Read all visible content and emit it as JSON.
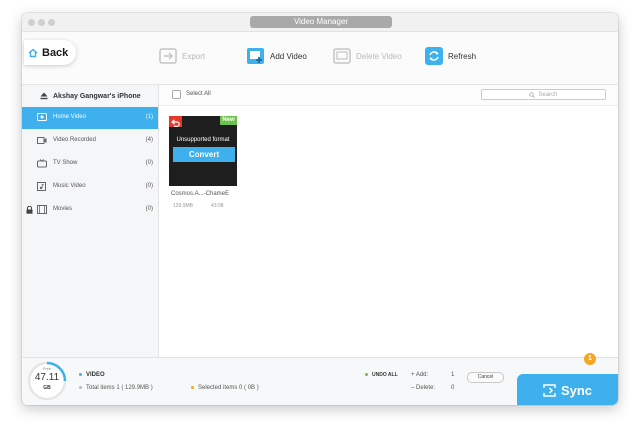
{
  "window": {
    "title": "Video Manager"
  },
  "toolbar": {
    "back": "Back",
    "export": "Export",
    "add_video": "Add Video",
    "delete_video": "Delete Video",
    "refresh": "Refresh"
  },
  "sidebar": {
    "device_name": "Akshay Gangwar's iPhone",
    "items": [
      {
        "label": "Home Video",
        "count": "(1)",
        "icon": "home-video-icon"
      },
      {
        "label": "Video Recorded",
        "count": "(4)",
        "icon": "camera-icon"
      },
      {
        "label": "TV Show",
        "count": "(0)",
        "icon": "tv-icon"
      },
      {
        "label": "Music Video",
        "count": "(0)",
        "icon": "music-video-icon"
      },
      {
        "label": "Movies",
        "count": "(0)",
        "icon": "film-icon"
      }
    ]
  },
  "content": {
    "select_all": "Select All",
    "search_placeholder": "Search",
    "video": {
      "badge": "New",
      "unsupported": "Unsupported format",
      "convert": "Convert",
      "name": "Cosmos.A...-ChameE",
      "size": "129.9MB",
      "duration": "43:08"
    }
  },
  "footer": {
    "free_label": "Free",
    "free_value": "47.11",
    "free_unit": "GB",
    "section": "VIDEO",
    "total": "Total items 1 ( 129.9MB )",
    "selected": "Selected items 0 ( 0B )",
    "undo_all": "UNDO ALL",
    "add_label": "Add:",
    "add_count": "1",
    "delete_label": "Delete:",
    "delete_count": "0",
    "cancel": "Cancel",
    "sync": "Sync",
    "sync_badge": "1"
  },
  "colors": {
    "accent": "#3fb0ee",
    "new_badge": "#6cc24a",
    "undo": "#e33a2c",
    "sync_badge": "#f5a623"
  }
}
